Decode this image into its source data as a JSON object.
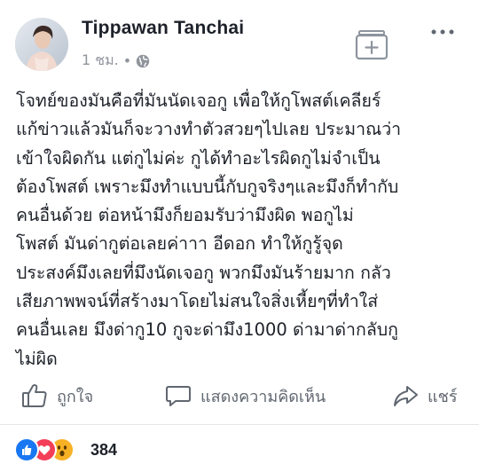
{
  "post": {
    "author": "Tippawan Tanchai",
    "time": "1 ชม.",
    "separator": "•",
    "text": "โจทย์ของมันคือที่มันนัดเจอกู เพื่อให้กูโพสต์เคลียร์\nแก้ข่าวแล้วมันก็จะวางทำตัวสวยๆไปเลย ประมาณว่า\nเข้าใจผิดกัน แต่กูไม่ค่ะ กูได้ทำอะไรผิดกูไม่จำเป็น\nต้องโพสต์ เพราะมึงทำแบบนี้กับกูจริงๆและมึงก็ทำกับ\nคนอื่นด้วย ต่อหน้ามึงก็ยอมรับว่ามึงผิด พอกูไม่\nโพสต์ มันด่ากูต่อเลยค่าาา อีดอก ทำให้กูรู้จุด\nประสงค์มึงเลยที่มึงนัดเจอกู พวกมึงมันร้ายมาก กลัว\nเสียภาพพจน์ที่สร้างมาโดยไม่สนใจสิ่งเหี้ยๆที่ทำใส่\nคนอื่นเลย มึงด่ากู10 กูจะด่ามึง1000 ด่ามาด่ากลับกู\nไม่ผิด"
  },
  "actions": {
    "like": "ถูกใจ",
    "comment": "แสดงความคิดเห็น",
    "share": "แชร์"
  },
  "reactions": {
    "types": [
      "like",
      "love",
      "wow"
    ],
    "count": "384"
  },
  "icons": {
    "save": "save-post-icon",
    "more": "more-options-icon",
    "privacy": "globe-icon"
  },
  "colors": {
    "text": "#1d2129",
    "muted": "#90949c",
    "action": "#606770",
    "like": "#1877f2",
    "love": "#f33e58",
    "wow": "#f7b125"
  }
}
